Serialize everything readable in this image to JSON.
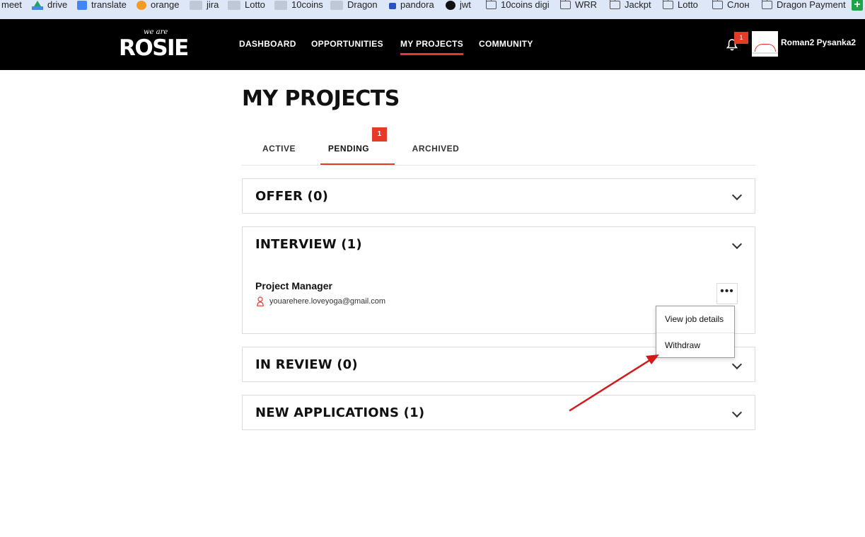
{
  "bookmarks": [
    {
      "label": "meet",
      "icon": "none"
    },
    {
      "label": "drive",
      "icon": "drive-icon"
    },
    {
      "label": "translate",
      "icon": "translate-icon"
    },
    {
      "label": "orange",
      "icon": "orange-icon"
    },
    {
      "label": "jira",
      "icon": "jira-icon"
    },
    {
      "label": "Lotto",
      "icon": "jira-icon"
    },
    {
      "label": "10coins",
      "icon": "jira-icon"
    },
    {
      "label": "Dragon",
      "icon": "jira-icon"
    },
    {
      "label": "pandora",
      "icon": "lock-icon"
    },
    {
      "label": "jwt",
      "icon": "jwt-icon"
    },
    {
      "label": "10coins digi",
      "icon": "folder-icon"
    },
    {
      "label": "WRR",
      "icon": "folder-icon"
    },
    {
      "label": "Jackpt",
      "icon": "folder-icon"
    },
    {
      "label": "Lotto",
      "icon": "folder-icon"
    },
    {
      "label": "Слон",
      "icon": "folder-icon"
    },
    {
      "label": "Dragon Payment",
      "icon": "folder-icon"
    }
  ],
  "header": {
    "logo_small": "we are",
    "logo": "ROSIE",
    "nav": [
      "DASHBOARD",
      "OPPORTUNITIES",
      "MY PROJECTS",
      "COMMUNITY"
    ],
    "active_nav": "MY PROJECTS",
    "notification_count": "1",
    "username": "Roman2 Pysanka2"
  },
  "page": {
    "title": "MY PROJECTS",
    "tabs": [
      {
        "label": "ACTIVE"
      },
      {
        "label": "PENDING",
        "badge": "1"
      },
      {
        "label": "ARCHIVED"
      }
    ],
    "active_tab": "PENDING"
  },
  "sections": {
    "offer": "OFFER (0)",
    "interview": "INTERVIEW (1)",
    "in_review": "IN REVIEW (0)",
    "new_applications": "NEW APPLICATIONS (1)"
  },
  "interview_item": {
    "title": "Project Manager",
    "email": "youarehere.loveyoga@gmail.com",
    "more": "•••"
  },
  "menu": {
    "view": "View job details",
    "withdraw": "Withdraw"
  },
  "colors": {
    "accent": "#e53a2a",
    "header_bg": "#000000",
    "arrow": "#d21a1a"
  }
}
